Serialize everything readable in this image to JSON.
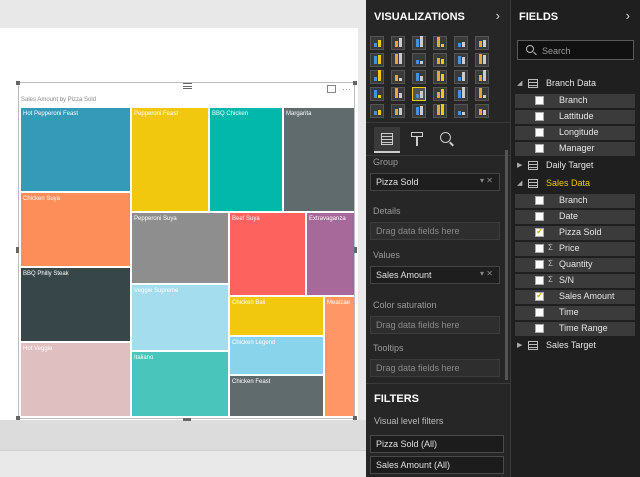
{
  "visual": {
    "title": "Sales Amount by Pizza Sold",
    "more_glyph": "···"
  },
  "chart_data": {
    "type": "treemap",
    "title": "Sales Amount by Pizza Sold",
    "tiles": [
      {
        "label": "Hot Pepperoni Feast",
        "color": "#3599b8"
      },
      {
        "label": "Chicken Suya",
        "color": "#fd8d59"
      },
      {
        "label": "BBQ Philly Steak",
        "color": "#374649"
      },
      {
        "label": "Hot Veggie",
        "color": "#dfbfbf"
      },
      {
        "label": "Pepperoni Feast",
        "color": "#f2c80f"
      },
      {
        "label": "Pepperoni Suya",
        "color": "#8e8e8e"
      },
      {
        "label": "Veggie Supreme",
        "color": "#a4ddee"
      },
      {
        "label": "Italiano",
        "color": "#4ac5bb"
      },
      {
        "label": "BBQ Chicken",
        "color": "#01b8aa"
      },
      {
        "label": "Margarita",
        "color": "#5f6b6d"
      },
      {
        "label": "Beef Suya",
        "color": "#fd625e"
      },
      {
        "label": "Extravaganza",
        "color": "#a66999"
      },
      {
        "label": "Chicken Bali",
        "color": "#f2c80f"
      },
      {
        "label": "Meatzae",
        "color": "#fe9666"
      },
      {
        "label": "Chicken Legend",
        "color": "#8ad4eb"
      },
      {
        "label": "Chicken Feast",
        "color": "#5f6b6d"
      }
    ]
  },
  "viz_pane": {
    "title": "VISUALIZATIONS",
    "chevron": "›",
    "wells": [
      {
        "label": "Group",
        "value": "Pizza Sold",
        "ctl": "▾ ✕"
      },
      {
        "label": "Details",
        "value": "Drag data fields here"
      },
      {
        "label": "Values",
        "value": "Sales Amount",
        "ctl": "▾ ✕"
      },
      {
        "label": "Color saturation",
        "value": "Drag data fields here"
      },
      {
        "label": "Tooltips",
        "value": "Drag data fields here"
      }
    ],
    "filters_title": "FILTERS",
    "visual_level_filters": "Visual level filters",
    "filters": [
      "Pizza Sold (All)",
      "Sales Amount (All)"
    ]
  },
  "fields_pane": {
    "title": "FIELDS",
    "chevron": "›",
    "search_placeholder": "Search",
    "tables": [
      {
        "name": "Branch Data",
        "expanded": true,
        "fields": [
          {
            "name": "Branch",
            "checked": false,
            "sigma": false
          },
          {
            "name": "Lattitude",
            "checked": false,
            "sigma": false
          },
          {
            "name": "Longitude",
            "checked": false,
            "sigma": false
          },
          {
            "name": "Manager",
            "checked": false,
            "sigma": false
          }
        ]
      },
      {
        "name": "Daily Target",
        "expanded": false,
        "fields": []
      },
      {
        "name": "Sales Data",
        "expanded": true,
        "highlight": true,
        "fields": [
          {
            "name": "Branch",
            "checked": false,
            "sigma": false
          },
          {
            "name": "Date",
            "checked": false,
            "sigma": false
          },
          {
            "name": "Pizza Sold",
            "checked": true,
            "sigma": false
          },
          {
            "name": "Price",
            "checked": false,
            "sigma": true
          },
          {
            "name": "Quantity",
            "checked": false,
            "sigma": true
          },
          {
            "name": "S/N",
            "checked": false,
            "sigma": true
          },
          {
            "name": "Sales Amount",
            "checked": true,
            "sigma": false
          },
          {
            "name": "Time",
            "checked": false,
            "sigma": false
          },
          {
            "name": "Time Range",
            "checked": false,
            "sigma": false
          }
        ]
      },
      {
        "name": "Sales Target",
        "expanded": false,
        "fields": []
      }
    ]
  },
  "colors": {
    "accent": "#f2c811",
    "pane_dark": "#262626",
    "fields_dark": "#1f1f1f"
  }
}
